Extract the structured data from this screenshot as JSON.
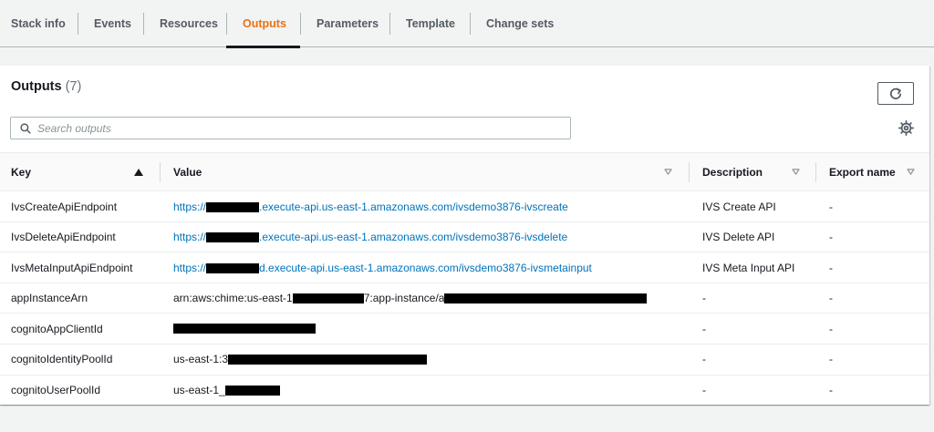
{
  "tabs": [
    {
      "label": "Stack info"
    },
    {
      "label": "Events"
    },
    {
      "label": "Resources"
    },
    {
      "label": "Outputs"
    },
    {
      "label": "Parameters"
    },
    {
      "label": "Template"
    },
    {
      "label": "Change sets"
    }
  ],
  "active_tab": "Outputs",
  "panel": {
    "title": "Outputs",
    "count": "(7)",
    "search_placeholder": "Search outputs"
  },
  "columns": {
    "key": "Key",
    "value": "Value",
    "description": "Description",
    "export": "Export name"
  },
  "rows": [
    {
      "key": "IvsCreateApiEndpoint",
      "value_a": "https://",
      "value_b": ".execute-api.us-east-1.amazonaws.com/ivsdemo3876-ivscreate",
      "description": "IVS Create API",
      "export": "-"
    },
    {
      "key": "IvsDeleteApiEndpoint",
      "value_a": "https://",
      "value_b": ".execute-api.us-east-1.amazonaws.com/ivsdemo3876-ivsdelete",
      "description": "IVS Delete API",
      "export": "-"
    },
    {
      "key": "IvsMetaInputApiEndpoint",
      "value_a": "https://",
      "value_b": "d.execute-api.us-east-1.amazonaws.com/ivsdemo3876-ivsmetainput",
      "description": "IVS Meta Input API",
      "export": "-"
    },
    {
      "key": "appInstanceArn",
      "value_a": "arn:aws:chime:us-east-1",
      "value_b": "7:app-instance/a",
      "description": "-",
      "export": "-"
    },
    {
      "key": "cognitoAppClientId",
      "value_a": "",
      "value_b": "",
      "description": "-",
      "export": "-"
    },
    {
      "key": "cognitoIdentityPoolId",
      "value_a": "us-east-1:3",
      "value_b": "",
      "description": "-",
      "export": "-"
    },
    {
      "key": "cognitoUserPoolId",
      "value_a": "us-east-1_",
      "value_b": "",
      "description": "-",
      "export": "-"
    }
  ],
  "colors": {
    "active_tab": "#ec7211",
    "link": "#0073bb",
    "redaction": "#000000"
  }
}
